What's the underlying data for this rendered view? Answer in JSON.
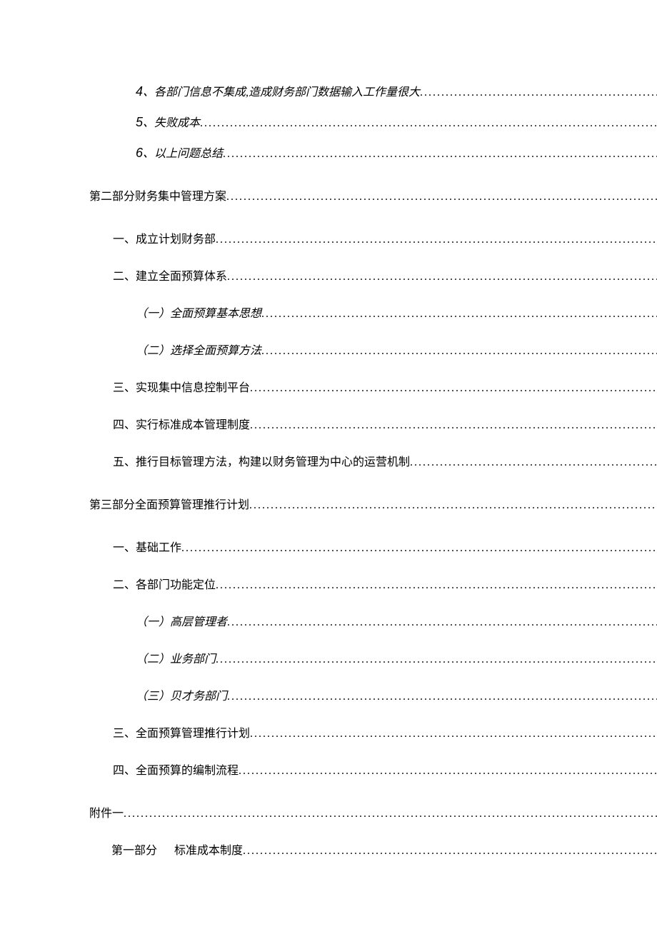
{
  "toc": {
    "item_4_num": "4",
    "item_4_sep": "、",
    "item_4_text": "各部门信息不集成,造成财务部门数据输入工作量很大",
    "item_5_num": "5",
    "item_5_sep": "、",
    "item_5_text": "失败成本",
    "item_6_num": "6",
    "item_6_sep": "、",
    "item_6_text": "以上问题总结",
    "part2_title": "第二部分财务集中管理方案",
    "p2_1": "一、成立计划财务部 ",
    "p2_2": "二、建立全面预算体系 ",
    "p2_2_1": "（一）全面预算基本思想",
    "p2_2_2": "（二）选择全面预算方法",
    "p2_3": "三、实现集中信息控制平台 ",
    "p2_4": "四、实行标准成本管理制度 ",
    "p2_5": "五、推行目标管理方法，构建以财务管理为中心的运营机制 ",
    "part3_title": "第三部分全面预算管理推行计划",
    "p3_1": "一、基础工作 ",
    "p3_2": "二、各部门功能定位 ",
    "p3_2_1": "（一）高层管理者",
    "p3_2_2": "（二）业务部门",
    "p3_2_3": "（三）贝才务部门",
    "p3_3": "三、全面预算管理推行计划 ",
    "p3_4": "四、全面预算的编制流程 ",
    "appendix": "附件一",
    "app_part1_label": "第一部分",
    "app_part1_text": "标准成本制度"
  },
  "leader": "..................................................................................................................................................."
}
